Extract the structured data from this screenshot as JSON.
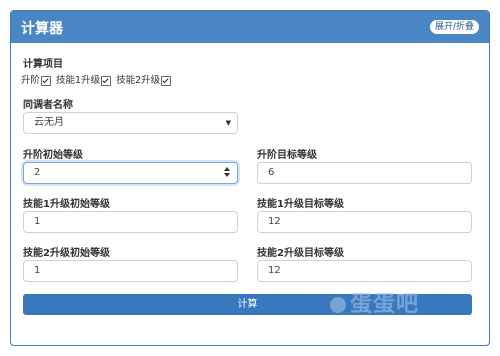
{
  "header": {
    "title": "计算器",
    "toggle_label": "展开/折叠"
  },
  "section": {
    "label": "计算项目"
  },
  "checkboxes": [
    {
      "label": "升阶",
      "checked": true
    },
    {
      "label": "技能1升级",
      "checked": true
    },
    {
      "label": "技能2升级",
      "checked": true
    }
  ],
  "character": {
    "label": "同调者名称",
    "selected": "云无月"
  },
  "ascension": {
    "start_label": "升阶初始等级",
    "start_value": "2",
    "target_label": "升阶目标等级",
    "target_value": "6"
  },
  "skill1": {
    "start_label": "技能1升级初始等级",
    "start_value": "1",
    "target_label": "技能1升级目标等级",
    "target_value": "12"
  },
  "skill2": {
    "start_label": "技能2升级初始等级",
    "start_value": "1",
    "target_label": "技能2升级目标等级",
    "target_value": "12"
  },
  "calculate_label": "计算",
  "watermark": {
    "text": "蛋蛋吧"
  },
  "colors": {
    "header": "#4a86c4",
    "button": "#3a78bd",
    "border": "#3f7cba"
  }
}
